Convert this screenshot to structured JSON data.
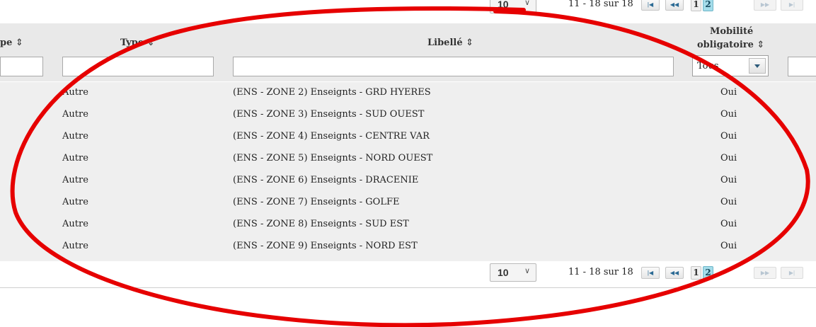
{
  "pagination": {
    "rows_per_page": "10",
    "range": "11 - 18 sur 18",
    "pages": [
      "1",
      "2"
    ],
    "active_page": "2",
    "first_label": "|◀",
    "prev_label": "◀◀",
    "next_label": "▶▶",
    "last_label": "▶|"
  },
  "columns": {
    "col0_label": "pe",
    "type_label": "Type",
    "libelle_label": "Libellé",
    "mobilite_label_1": "Mobilité",
    "mobilite_label_2": "obligatoire",
    "sort_icon": "⇕"
  },
  "filters": {
    "mobilite_selected": "Tous"
  },
  "rows": [
    {
      "type": "Autre",
      "libelle": "(ENS - ZONE 2) Enseignts - GRD HYERES",
      "mobilite": "Oui"
    },
    {
      "type": "Autre",
      "libelle": "(ENS - ZONE 3) Enseignts - SUD OUEST",
      "mobilite": "Oui"
    },
    {
      "type": "Autre",
      "libelle": "(ENS - ZONE 4) Enseignts - CENTRE VAR",
      "mobilite": "Oui"
    },
    {
      "type": "Autre",
      "libelle": "(ENS - ZONE 5) Enseignts - NORD OUEST",
      "mobilite": "Oui"
    },
    {
      "type": "Autre",
      "libelle": "(ENS - ZONE 6) Enseignts - DRACENIE",
      "mobilite": "Oui"
    },
    {
      "type": "Autre",
      "libelle": "(ENS - ZONE 7) Enseignts - GOLFE",
      "mobilite": "Oui"
    },
    {
      "type": "Autre",
      "libelle": "(ENS - ZONE 8) Enseignts - SUD EST",
      "mobilite": "Oui"
    },
    {
      "type": "Autre",
      "libelle": "(ENS - ZONE 9) Enseignts - NORD EST",
      "mobilite": "Oui"
    }
  ],
  "colors": {
    "annotation": "#e60000",
    "active_page": "#a4dcea",
    "header_bg": "#e9e9e9",
    "row_bg": "#efefef"
  }
}
